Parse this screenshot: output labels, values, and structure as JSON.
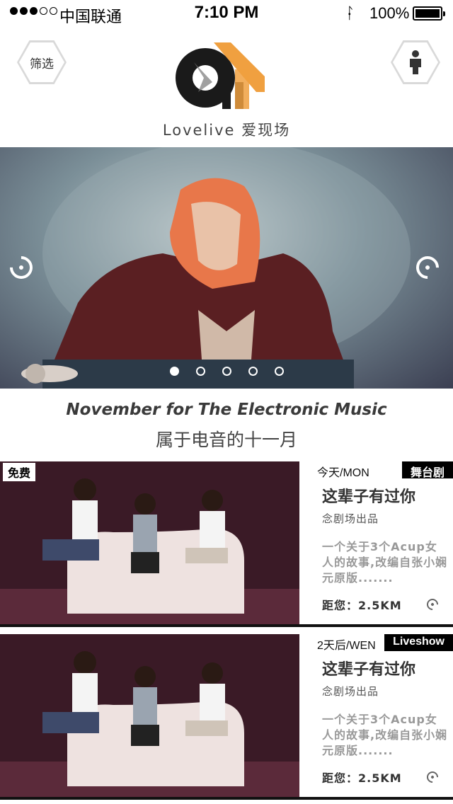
{
  "status_bar": {
    "carrier": "中国联通",
    "time": "7:10 PM",
    "bluetooth_icon": "bluetooth-icon",
    "battery_percent": "100%"
  },
  "header": {
    "filter_label": "筛选",
    "user_icon": "person-icon",
    "brand": "Lovelive 爱现场"
  },
  "banner": {
    "title_en": "November for The Electronic Music",
    "title_cn": "属于电音的十一月",
    "slide_count": 5,
    "active_slide": 1
  },
  "events": [
    {
      "free_tag": "免费",
      "date": "今天/MON",
      "category": "舞台剧",
      "title": "这辈子有过你",
      "organizer": "念剧场出品",
      "description": "一个关于3个Acup女人的故事,改编自张小娴元原版.......",
      "distance": "距您：2.5KM"
    },
    {
      "free_tag": "",
      "date": "2天后/WEN",
      "category": "Liveshow",
      "title": "这辈子有过你",
      "organizer": "念剧场出品",
      "description": "一个关于3个Acup女人的故事,改编自张小娴元原版.......",
      "distance": "距您：2.5KM"
    }
  ],
  "colors": {
    "accent_orange": "#f0a040",
    "text_dark": "#333333",
    "category_bg": "#000000"
  }
}
